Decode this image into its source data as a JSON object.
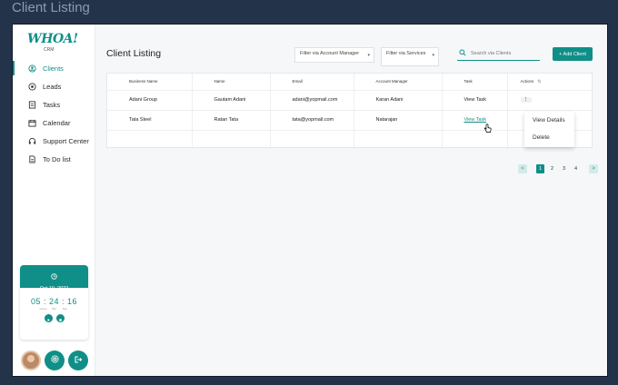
{
  "window": {
    "title": "Client Listing"
  },
  "logo": {
    "text": "WHOA!",
    "sub": "CRM"
  },
  "sidebar": {
    "items": [
      {
        "label": "Clients",
        "icon": "users-icon",
        "active": true
      },
      {
        "label": "Leads",
        "icon": "leads-icon"
      },
      {
        "label": "Tasks",
        "icon": "tasks-icon"
      },
      {
        "label": "Calendar",
        "icon": "calendar-icon"
      },
      {
        "label": "Support Center",
        "icon": "headset-icon"
      },
      {
        "label": "To Do list",
        "icon": "todo-icon"
      }
    ]
  },
  "timer": {
    "date": "Oct 10, 2022",
    "time": "05 : 24 : 16",
    "units": [
      "Hours",
      "Min",
      "Sec"
    ]
  },
  "main": {
    "title": "Client Listing",
    "filter_manager": "Filter via Account Manager",
    "filter_services": "Filter via Services",
    "search_placeholder": "Search via Clients",
    "add_button": "+ Add Client"
  },
  "table": {
    "headers": [
      "Business Name",
      "Name",
      "Email",
      "Account Manager",
      "Task",
      "Actions"
    ],
    "rows": [
      {
        "business": "Adani Group",
        "name": "Gautam Adani",
        "email": "adani@yopmail.com",
        "manager": "Karan Adani",
        "task": "View Task"
      },
      {
        "business": "Tata Steel",
        "name": "Ratan Tata",
        "email": "tata@yopmail.com",
        "manager": "Natarajan",
        "task": "View Task"
      }
    ]
  },
  "dropdown": {
    "items": [
      "View Details",
      "Delete"
    ]
  },
  "pagination": {
    "prev": "<",
    "next": ">",
    "pages": [
      "1",
      "2",
      "3",
      "4"
    ],
    "current": "1"
  },
  "colors": {
    "accent": "#0f8f88",
    "background": "#23344a"
  }
}
